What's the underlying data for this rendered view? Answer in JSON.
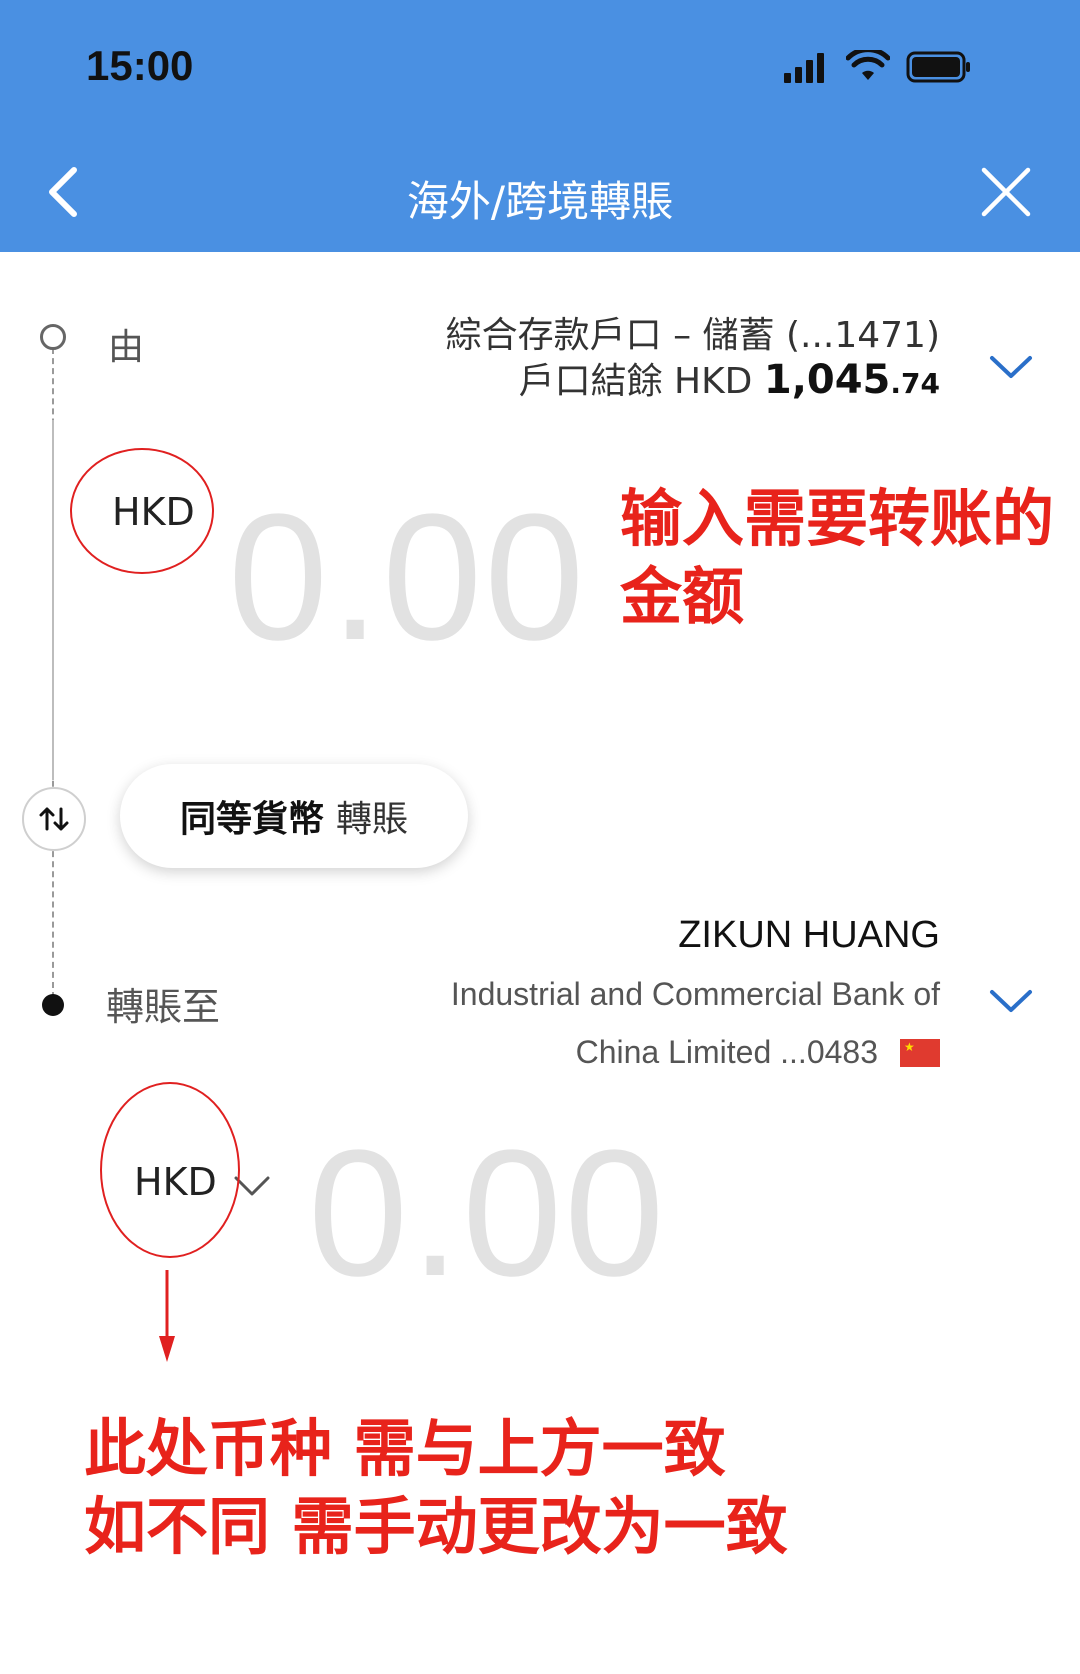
{
  "status_bar": {
    "time": "15:00"
  },
  "nav": {
    "title": "海外/跨境轉賬"
  },
  "from": {
    "label": "由",
    "account": "綜合存款戶口 – 儲蓄 (...1471)",
    "balance_prefix": "戶口結餘 HKD ",
    "balance_main": "1,045",
    "balance_decimal": ".74",
    "currency": "HKD",
    "amount": "0.00"
  },
  "equal_currency_button": {
    "bold": "同等貨幣",
    "light": "轉賬"
  },
  "to": {
    "label": "轉賬至",
    "payee_name": "ZIKUN HUANG",
    "bank_line1": "Industrial and Commercial Bank of",
    "bank_line2": "China Limited ...0483",
    "currency": "HKD",
    "amount": "0.00"
  },
  "annotations": {
    "top": "输入需要转账的\n金额",
    "bottom": "此处币种 需与上方一致\n如不同 需手动更改为一致"
  },
  "colors": {
    "header_blue": "#4a90e2",
    "annotation_red": "#e8231b",
    "amount_gray": "#e2e2e2"
  }
}
